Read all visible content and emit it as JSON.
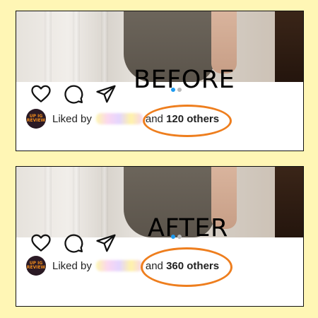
{
  "panels": [
    {
      "overlay": "BEFORE",
      "liked_by": "Liked by",
      "and": "and",
      "count_text": "120 others",
      "avatar_text": "UP IG REVIEW"
    },
    {
      "overlay": "AFTER",
      "liked_by": "Liked by",
      "and": "and",
      "count_text": "360 others",
      "avatar_text": "UP IG REVIEW"
    }
  ],
  "icons": [
    "heart-icon",
    "comment-icon",
    "share-icon"
  ],
  "colors": {
    "background": "#FFF6B5",
    "highlight_ring": "#EE7E1E",
    "active_dot": "#1d9bf0"
  }
}
